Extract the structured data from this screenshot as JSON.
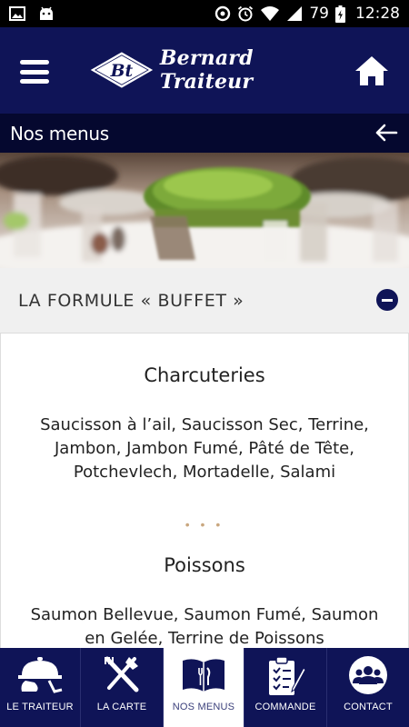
{
  "status_bar": {
    "battery": "79",
    "time": "12:28",
    "icons": [
      "image-icon",
      "android-icon",
      "data-saver-icon",
      "alarm-icon",
      "wifi-icon",
      "signal-icon",
      "battery-charging-icon"
    ]
  },
  "header": {
    "logo_monogram": "Bt",
    "brand": "Bernard Traiteur",
    "menu_icon": "hamburger-menu-icon",
    "home_icon": "home-icon"
  },
  "section": {
    "title": "Nos menus",
    "back_icon": "back-arrow-icon"
  },
  "accordion": {
    "title": "LA FORMULE « BUFFET »",
    "state_icon": "collapse-minus-icon"
  },
  "content": {
    "categories": [
      {
        "title": "Charcuteries",
        "lines": [
          "Saucisson à l’ail, Saucisson Sec, Terrine,",
          "Jambon, Jambon Fumé, Pâté de Tête,",
          "Potchevlech, Mortadelle, Salami"
        ]
      },
      {
        "title": "Poissons",
        "lines": [
          "Saumon Bellevue, Saumon Fumé, Saumon",
          "en Gelée, Terrine de Poissons"
        ]
      }
    ],
    "separator": "• • •"
  },
  "bottom_nav": {
    "items": [
      {
        "label": "LE TRAITEUR",
        "icon": "waiter-cloche-icon",
        "active": false
      },
      {
        "label": "LA CARTE",
        "icon": "fork-knife-icon",
        "active": false
      },
      {
        "label": "NOS MENUS",
        "icon": "menu-book-icon",
        "active": true
      },
      {
        "label": "COMMANDE",
        "icon": "clipboard-order-icon",
        "active": false
      },
      {
        "label": "CONTACT",
        "icon": "contact-group-icon",
        "active": false
      }
    ]
  },
  "colors": {
    "header_navy": "#0f1457",
    "section_bar": "#05082f",
    "accent_dots": "#c9a77f"
  }
}
